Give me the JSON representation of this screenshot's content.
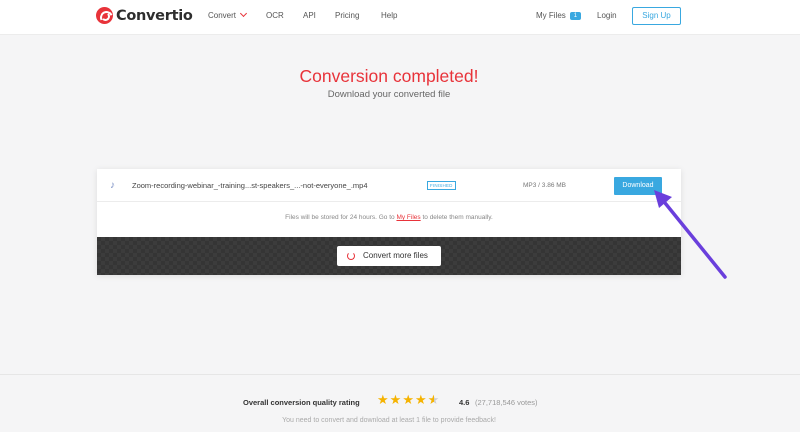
{
  "header": {
    "logo_text": "Convertio",
    "nav": [
      {
        "label": "Convert"
      },
      {
        "label": "OCR"
      },
      {
        "label": "API"
      },
      {
        "label": "Pricing"
      },
      {
        "label": "Help"
      }
    ],
    "my_files_label": "My Files",
    "my_files_count": "1",
    "login_label": "Login",
    "signup_label": "Sign Up"
  },
  "hero": {
    "title": "Conversion completed!",
    "subtitle": "Download your converted file"
  },
  "file": {
    "icon": "music-note-icon",
    "name": "Zoom-recording-webinar_-training...st-speakers_...-not-everyone_.mp4",
    "status": "FINISHED",
    "meta": "MP3 / 3.86 MB",
    "download_label": "Download"
  },
  "notice": {
    "before": "Files will be stored for 24 hours. Go to ",
    "link": "My Files",
    "after": " to delete them manually."
  },
  "convert_more_label": "Convert more files",
  "footer": {
    "rating_label": "Overall conversion quality rating",
    "stars": 4.5,
    "score": "4.6",
    "votes": "(27,718,546 votes)",
    "footnote": "You need to convert and download at least 1 file to provide feedback!"
  },
  "colors": {
    "brand_red": "#e8333a",
    "accent_blue": "#39a8e0",
    "annotation_arrow": "#6a3fdc"
  }
}
